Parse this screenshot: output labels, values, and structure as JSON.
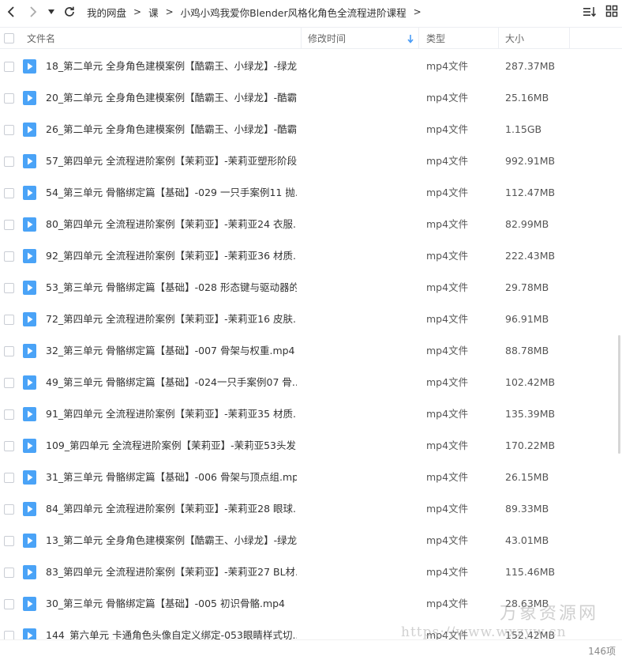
{
  "breadcrumb": [
    "我的网盘",
    "课",
    "小鸡小鸡我爱你Blender风格化角色全流程进阶课程"
  ],
  "columns": {
    "name": "文件名",
    "modified": "修改时间",
    "type": "类型",
    "size": "大小"
  },
  "files": [
    {
      "name": "18_第二单元 全身角色建模案例【酷霸王、小绿龙】-绿龙...",
      "type": "mp4文件",
      "size": "287.37MB"
    },
    {
      "name": "20_第二单元 全身角色建模案例【酷霸王、小绿龙】-酷霸...",
      "type": "mp4文件",
      "size": "25.16MB"
    },
    {
      "name": "26_第二单元 全身角色建模案例【酷霸王、小绿龙】-酷霸...",
      "type": "mp4文件",
      "size": "1.15GB"
    },
    {
      "name": "57_第四单元 全流程进阶案例【茉莉亚】-茉莉亚塑形阶段...",
      "type": "mp4文件",
      "size": "992.91MB"
    },
    {
      "name": "54_第三单元 骨骼绑定篇【基础】-029 一只手案例11 抛...",
      "type": "mp4文件",
      "size": "112.47MB"
    },
    {
      "name": "80_第四单元 全流程进阶案例【茉莉亚】-茉莉亚24 衣服...",
      "type": "mp4文件",
      "size": "82.99MB"
    },
    {
      "name": "92_第四单元 全流程进阶案例【茉莉亚】-茉莉亚36 材质...",
      "type": "mp4文件",
      "size": "222.43MB"
    },
    {
      "name": "53_第三单元 骨骼绑定篇【基础】-028 形态键与驱动器的...",
      "type": "mp4文件",
      "size": "29.78MB"
    },
    {
      "name": "72_第四单元 全流程进阶案例【茉莉亚】-茉莉亚16 皮肤...",
      "type": "mp4文件",
      "size": "96.91MB"
    },
    {
      "name": "32_第三单元 骨骼绑定篇【基础】-007 骨架与权重.mp4",
      "type": "mp4文件",
      "size": "88.78MB"
    },
    {
      "name": "49_第三单元 骨骼绑定篇【基础】-024一只手案例07 骨...",
      "type": "mp4文件",
      "size": "102.42MB"
    },
    {
      "name": "91_第四单元 全流程进阶案例【茉莉亚】-茉莉亚35 材质...",
      "type": "mp4文件",
      "size": "135.39MB"
    },
    {
      "name": "109_第四单元 全流程进阶案例【茉莉亚】-茉莉亚53头发...",
      "type": "mp4文件",
      "size": "170.22MB"
    },
    {
      "name": "31_第三单元 骨骼绑定篇【基础】-006 骨架与顶点组.mp4",
      "type": "mp4文件",
      "size": "26.15MB"
    },
    {
      "name": "84_第四单元 全流程进阶案例【茉莉亚】-茉莉亚28 眼球...",
      "type": "mp4文件",
      "size": "89.33MB"
    },
    {
      "name": "13_第二单元 全身角色建模案例【酷霸王、小绿龙】-绿龙...",
      "type": "mp4文件",
      "size": "43.01MB"
    },
    {
      "name": "83_第四单元 全流程进阶案例【茉莉亚】-茉莉亚27 BL材...",
      "type": "mp4文件",
      "size": "115.46MB"
    },
    {
      "name": "30_第三单元 骨骼绑定篇【基础】-005 初识骨骼.mp4",
      "type": "mp4文件",
      "size": "28.63MB"
    },
    {
      "name": "144_第六单元 卡通角色头像自定义绑定-053眼睛样式切...",
      "type": "mp4文件",
      "size": "152.42MB"
    }
  ],
  "item_count": "146项",
  "watermark": {
    "text": "万象资源网",
    "url": "https://www.wxzyw.cn"
  },
  "colors": {
    "accent": "#4a9cf6",
    "icon_blue": "#4aa3f7",
    "border": "#eceef2"
  },
  "icons": {
    "back": "chevron-left-icon",
    "forward": "chevron-right-icon",
    "history": "caret-down-icon",
    "refresh": "refresh-icon",
    "sort": "sort-icon",
    "view": "grid-view-icon",
    "file": "video-file-icon"
  }
}
